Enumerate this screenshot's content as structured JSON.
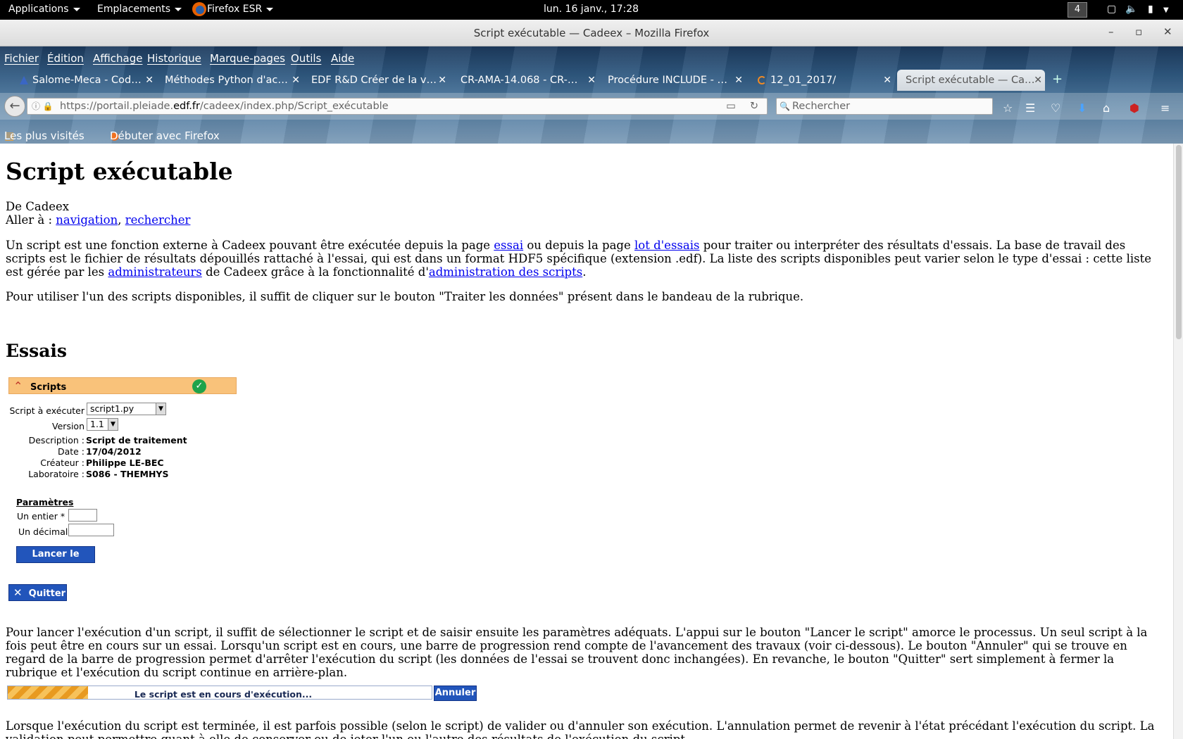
{
  "gnome": {
    "applications": "Applications",
    "places": "Emplacements",
    "firefox_menu": "Firefox ESR",
    "clock": "lun. 16 janv., 17:28",
    "workspace": "4"
  },
  "window": {
    "title": "Script exécutable — Cadeex – Mozilla Firefox",
    "minimize": "–",
    "maximize": "▫",
    "close": "✕"
  },
  "menu": [
    "Fichier",
    "Édition",
    "Affichage",
    "Historique",
    "Marque-pages",
    "Outils",
    "Aide"
  ],
  "tabs": [
    {
      "label": "Salome-Meca - Cod…",
      "close": "✕"
    },
    {
      "label": "Méthodes Python d'ac…",
      "close": "✕"
    },
    {
      "label": "EDF R&D Créer de la v…",
      "close": "✕"
    },
    {
      "label": "CR-AMA-14.068 - CR-…",
      "close": "✕"
    },
    {
      "label": "Procédure INCLUDE - …",
      "close": "✕"
    },
    {
      "label": "12_01_2017/",
      "close": "✕"
    },
    {
      "label": "Script exécutable — Ca…",
      "close": "✕"
    }
  ],
  "new_tab": "+",
  "url": {
    "prefix": "https://portail.pleiade.",
    "domain": "edf.fr",
    "suffix": "/cadeex/index.php/Script_exécutable"
  },
  "search_placeholder": "Rechercher",
  "bookmarks": [
    "Les plus visités",
    "Débuter avec Firefox"
  ],
  "page": {
    "title": "Script exécutable",
    "from": "De Cadeex",
    "goto_label": "Aller à :",
    "goto_nav": "navigation",
    "goto_sep": ",",
    "goto_search": "rechercher",
    "intro": {
      "t1": "Un script est une fonction externe à Cadeex pouvant être exécutée depuis la page ",
      "l1": "essai",
      "t2": " ou depuis la page ",
      "l2": "lot d'essais",
      "t3": " pour traiter ou interpréter des résultats d'essais. La base de travail des scripts est le fichier de résultats dépouillés rattaché à l'essai, qui est dans un format HDF5 spécifique (extension .edf). La liste des scripts disponibles peut varier selon le type d'essai : cette liste est gérée par les ",
      "l3": "administrateurs",
      "t4": " de Cadeex grâce à la fonctionnalité d'",
      "l4": "administration des scripts",
      "t5": "."
    },
    "usage": "Pour utiliser l'un des scripts disponibles, il suffit de cliquer sur le bouton \"Traiter les données\" présent dans le bandeau de la rubrique.",
    "section_essais": "Essais",
    "panel": {
      "title": "Scripts",
      "script_label": "Script à exécuter",
      "script_value": "script1.py",
      "version_label": "Version",
      "version_value": "1.1",
      "description_label": "Description :",
      "description_value": "Script de traitement",
      "date_label": "Date :",
      "date_value": "17/04/2012",
      "creator_label": "Créateur :",
      "creator_value": "Philippe LE-BEC",
      "lab_label": "Laboratoire :",
      "lab_value": "S086 - THEMHYS",
      "params_title": "Paramètres",
      "param1_label": "Un entier *",
      "param2_label": "Un décimal",
      "run_button": "Lancer le script",
      "quit_button": "Quitter"
    },
    "run_paragraph": "Pour lancer l'exécution d'un script, il suffit de sélectionner le script et de saisir ensuite les paramètres adéquats. L'appui sur le bouton \"Lancer le script\" amorce le processus. Un seul script à la fois peut être en cours sur un essai. Lorsqu'un script est en cours, une barre de progression rend compte de l'avancement des travaux (voir ci-dessous). Le bouton \"Annuler\" qui se trouve en regard de la barre de progression permet d'arrêter l'exécution du script (les données de l'essai se trouvent donc inchangées). En revanche, le bouton \"Quitter\" sert simplement à fermer la rubrique et l'exécution du script continue en arrière-plan.",
    "progress": {
      "text": "Le script est en cours d'exécution...",
      "fraction": 0.19,
      "cancel": "Annuler"
    },
    "end_paragraph": "Lorsque l'exécution du script est terminée, il est parfois possible (selon le script) de valider ou d'annuler son exécution. L'annulation permet de revenir à l'état précédant l'exécution du script. La validation peut permettre quant à elle de conserver ou de jeter l'un ou l'autre des résultats de l'exécution du script."
  }
}
